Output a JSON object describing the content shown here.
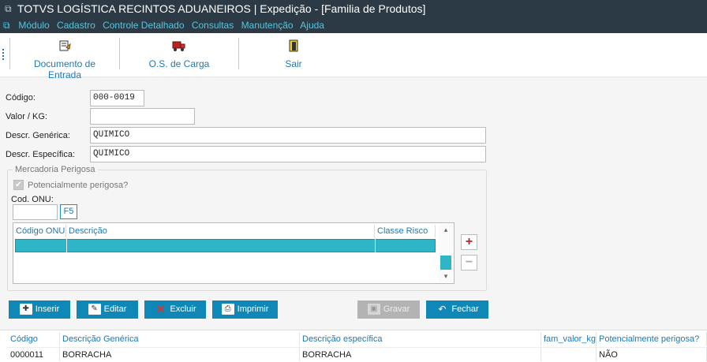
{
  "window": {
    "title": "TOTVS LOGÍSTICA RECINTOS ADUANEIROS | Expedição - [Familia de Produtos]"
  },
  "menu": {
    "items": [
      "Módulo",
      "Cadastro",
      "Controle Detalhado",
      "Consultas",
      "Manutenção",
      "Ajuda"
    ]
  },
  "toolbar": {
    "documento_label": "Documento de Entrada",
    "os_label": "O.S. de Carga",
    "sair_label": "Sair"
  },
  "form": {
    "codigo_label": "Código:",
    "codigo_value": "000-0019",
    "valor_label": "Valor / KG:",
    "valor_value": "",
    "descr_generica_label": "Descr. Genérica:",
    "descr_generica_value": "QUIMICO",
    "descr_especifica_label": "Descr. Específica:",
    "descr_especifica_value": "QUIMICO"
  },
  "mercadoria": {
    "group_title": "Mercadoria Perigosa",
    "checkbox_label": "Potencialmente perigosa?",
    "checked": true,
    "onu_label": "Cod. ONU:",
    "onu_value": "",
    "f5_label": "F5",
    "grid_headers": [
      "Código ONU",
      "Descrição",
      "Classe Risco"
    ]
  },
  "actions": {
    "inserir": "Inserir",
    "editar": "Editar",
    "excluir": "Excluir",
    "imprimir": "Imprimir",
    "gravar": "Gravar",
    "fechar": "Fechar"
  },
  "table": {
    "headers": [
      "Código",
      "Descrição Genérica",
      "Descrição específica",
      "fam_valor_kg",
      "Potencialmente perigosa?"
    ],
    "rows": [
      [
        "0000011",
        "BORRACHA",
        "BORRACHA",
        "",
        "NÃO"
      ]
    ]
  },
  "colors": {
    "accent": "#0f88b8",
    "title_bg": "#2b3a45",
    "menu_text": "#54c7e0",
    "selected_row": "#2fb5c8"
  },
  "icons": [
    "app-icon",
    "menu-app-icon",
    "document-icon",
    "truck-icon",
    "exit-door-icon",
    "add-icon",
    "remove-icon",
    "insert-icon",
    "edit-icon",
    "delete-icon",
    "print-icon",
    "save-icon",
    "back-arrow-icon",
    "checkmark-icon"
  ]
}
